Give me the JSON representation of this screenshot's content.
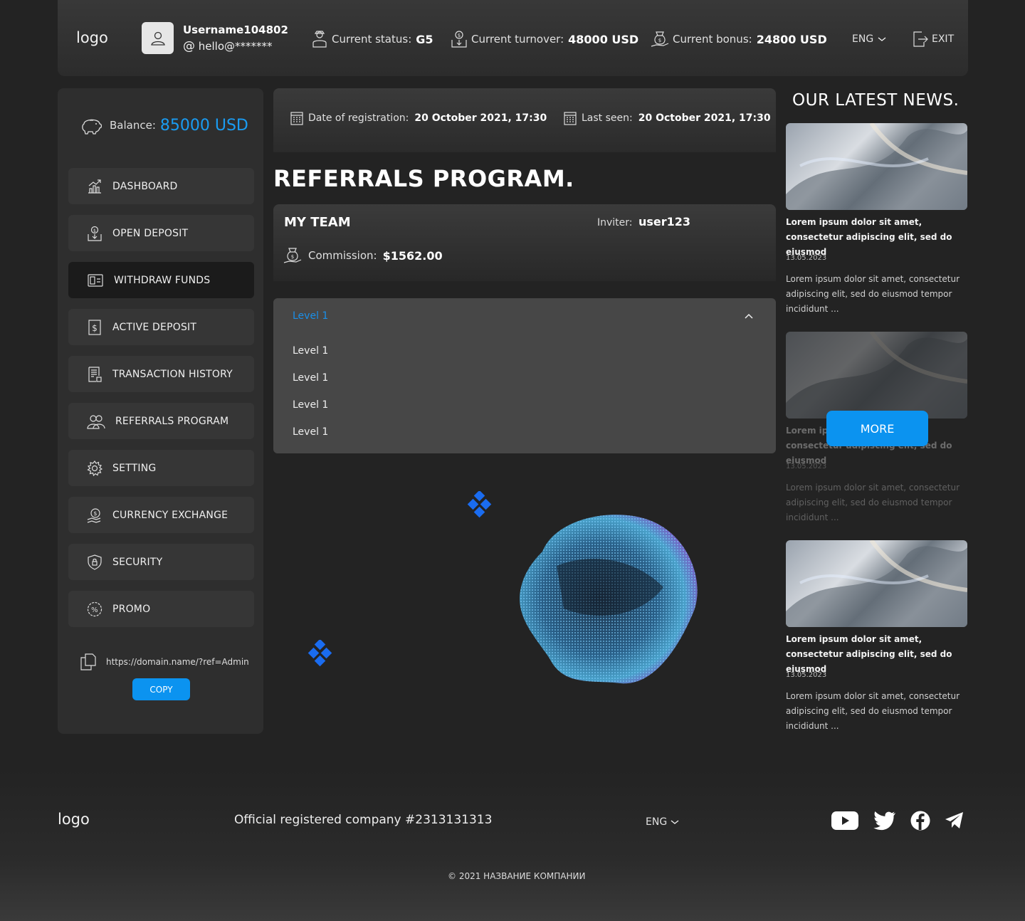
{
  "header": {
    "logo": "logo",
    "username": "Username104802",
    "email": "hello@*******",
    "status_label": "Current status:",
    "status_value": "G5",
    "turnover_label": "Current turnover:",
    "turnover_value": "48000 USD",
    "bonus_label": "Current bonus:",
    "bonus_value": "24800 USD",
    "language": "ENG",
    "exit_label": "EXIT"
  },
  "sidebar": {
    "balance_label": "Balance:",
    "balance_value": "85000 USD",
    "items": [
      {
        "label": "DASHBOARD",
        "icon": "chart-icon"
      },
      {
        "label": "OPEN DEPOSIT",
        "icon": "deposit-icon"
      },
      {
        "label": "WITHDRAW FUNDS",
        "icon": "wallet-icon"
      },
      {
        "label": "ACTIVE DEPOSIT",
        "icon": "dollar-icon"
      },
      {
        "label": "TRANSACTION HISTORY",
        "icon": "history-icon"
      },
      {
        "label": "REFERRALS PROGRAM",
        "icon": "users-icon"
      },
      {
        "label": "SETTING",
        "icon": "gear-icon"
      },
      {
        "label": "CURRENCY EXCHANGE",
        "icon": "exchange-icon"
      },
      {
        "label": "SECURITY",
        "icon": "shield-icon"
      },
      {
        "label": "PROMO",
        "icon": "percent-icon"
      }
    ],
    "active_index": 2,
    "ref_url": "https://domain.name/?ref=Admin",
    "copy_label": "COPY"
  },
  "main": {
    "registration_label": "Date of registration:",
    "registration_value": "20 October 2021, 17:30",
    "last_seen_label": "Last seen:",
    "last_seen_value": "20 October 2021, 17:30",
    "page_title": "REFERRALS PROGRAM.",
    "team_title": "MY TEAM",
    "inviter_label": "Inviter:",
    "inviter_value": "user123",
    "commission_label": "Commission:",
    "commission_value": "$1562.00",
    "dropdown": {
      "selected": "Level 1",
      "options": [
        "Level 1",
        "Level 1",
        "Level 1",
        "Level 1"
      ]
    }
  },
  "news": {
    "title": "OUR LATEST NEWS.",
    "items": [
      {
        "headline": "Lorem ipsum dolor sit amet, consectetur adipiscing elit, sed do eiusmod",
        "date": "13.05.2023",
        "body": "Lorem ipsum dolor sit amet, consectetur adipiscing elit, sed do eiusmod tempor incididunt ..."
      },
      {
        "headline": "Lorem ipsum dolor sit amet, consectetur adipiscing elit, sed do eiusmod",
        "date": "13.05.2023",
        "body": "Lorem ipsum dolor sit amet, consectetur adipiscing elit, sed do eiusmod tempor incididunt ..."
      },
      {
        "headline": "Lorem ipsum dolor sit amet, consectetur adipiscing elit, sed do eiusmod",
        "date": "13.05.2023",
        "body": "Lorem ipsum dolor sit amet, consectetur adipiscing elit, sed do eiusmod tempor incididunt ..."
      }
    ],
    "more_label": "MORE"
  },
  "footer": {
    "logo": "logo",
    "company_text": "Official registered company #2313131313",
    "language": "ENG",
    "copyright": "© 2021 НАЗВАНИЕ КОМПАНИИ",
    "social": [
      "youtube-icon",
      "twitter-icon",
      "facebook-icon",
      "telegram-icon"
    ]
  },
  "colors": {
    "accent": "#0b93f0",
    "background": "#232323",
    "panel": "#2e2e2e"
  }
}
